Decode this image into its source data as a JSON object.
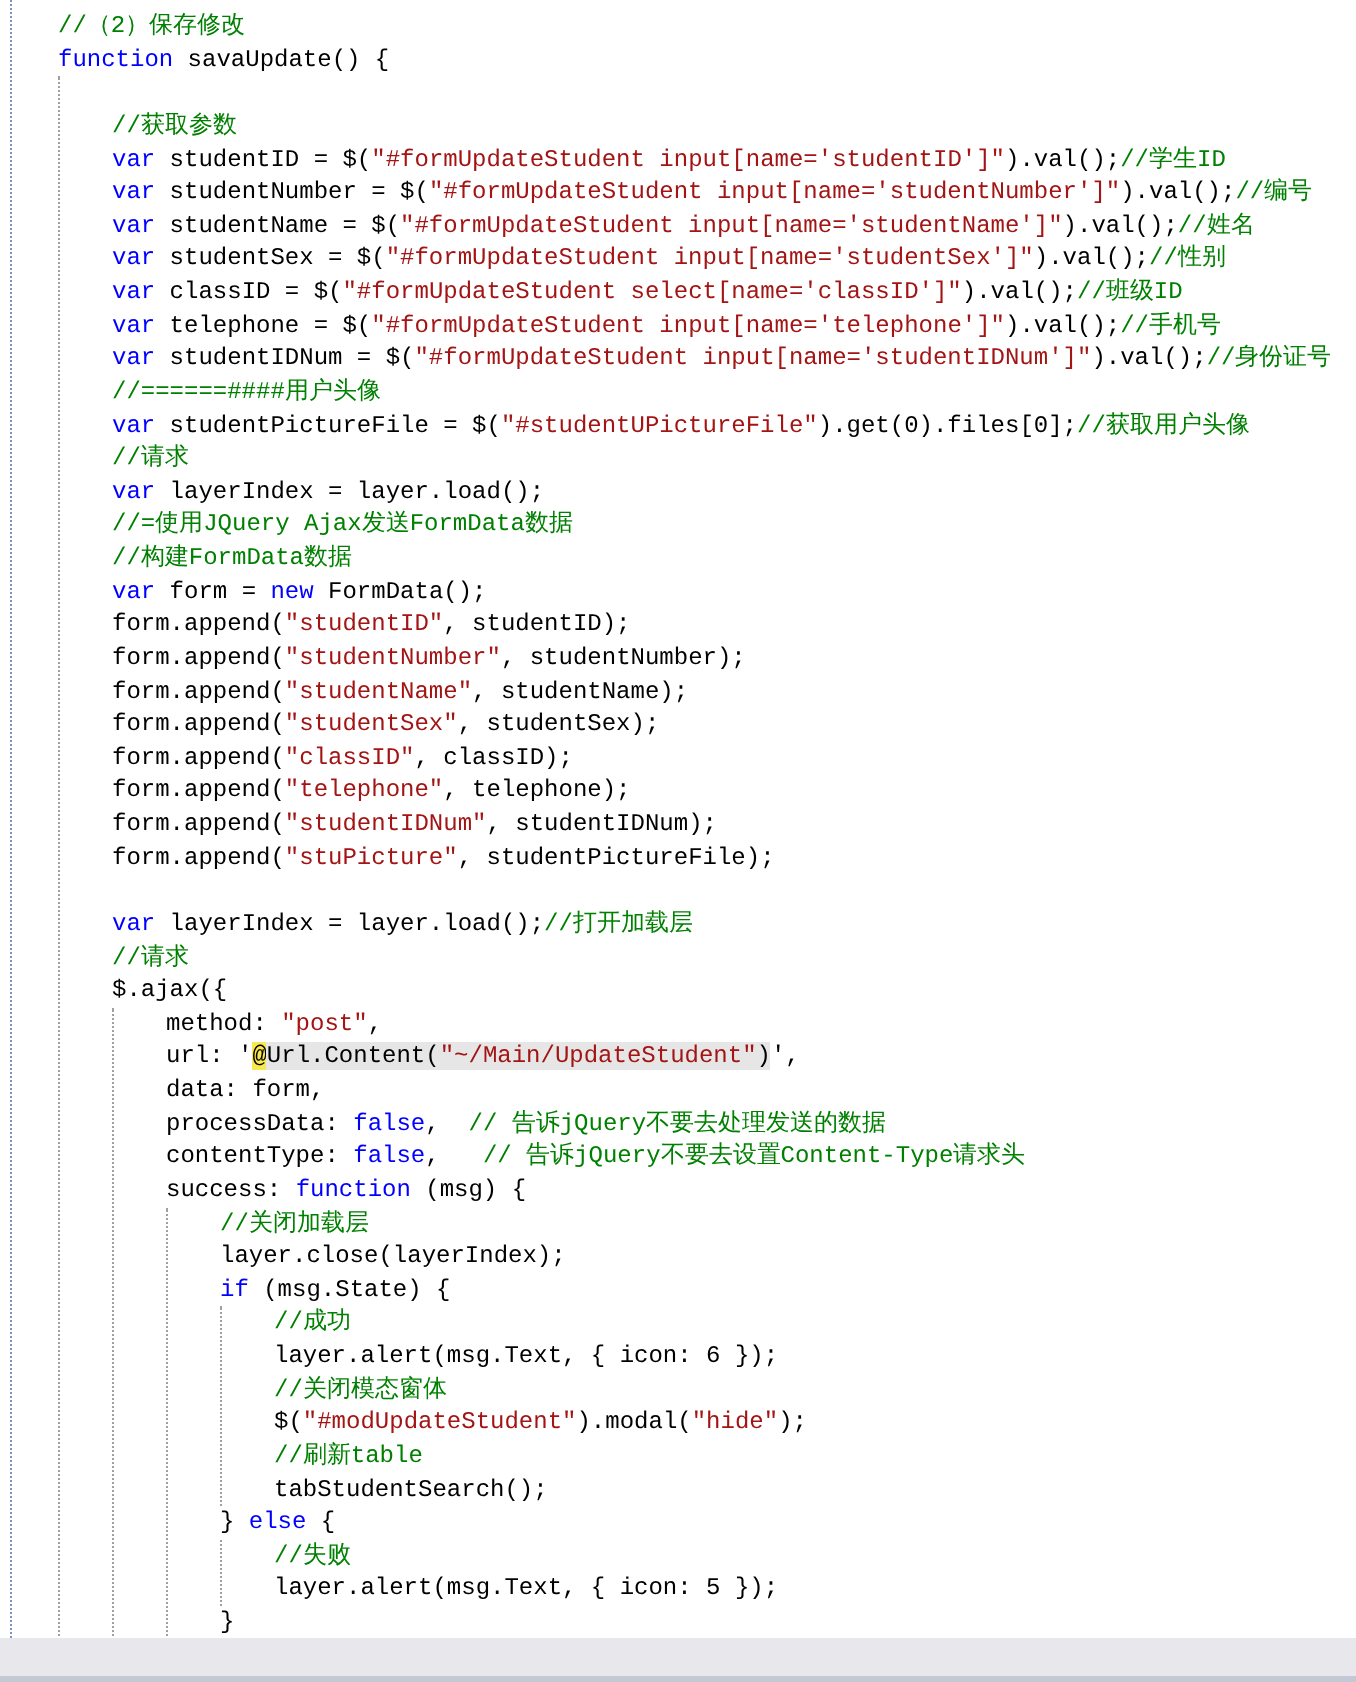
{
  "editor": {
    "lines": [
      {
        "kind": "code",
        "tokens": [
          {
            "kind": "cmt",
            "text": "//（2）保存修改"
          }
        ]
      },
      {
        "kind": "code",
        "tokens": [
          {
            "kind": "kw",
            "text": "function"
          },
          {
            "kind": "plain",
            "text": " savaUpdate() {"
          }
        ],
        "children": [
          {
            "kind": "blank"
          },
          {
            "kind": "code",
            "tokens": [
              {
                "kind": "cmt",
                "text": "//获取参数"
              }
            ]
          },
          {
            "kind": "code",
            "tokens": [
              {
                "kind": "kw",
                "text": "var"
              },
              {
                "kind": "plain",
                "text": " studentID = $("
              },
              {
                "kind": "str",
                "text": "\"#formUpdateStudent input[name='studentID']\""
              },
              {
                "kind": "plain",
                "text": ").val();"
              },
              {
                "kind": "cmt",
                "text": "//学生ID"
              }
            ]
          },
          {
            "kind": "code",
            "tokens": [
              {
                "kind": "kw",
                "text": "var"
              },
              {
                "kind": "plain",
                "text": " studentNumber = $("
              },
              {
                "kind": "str",
                "text": "\"#formUpdateStudent input[name='studentNumber']\""
              },
              {
                "kind": "plain",
                "text": ").val();"
              },
              {
                "kind": "cmt",
                "text": "//编号"
              }
            ]
          },
          {
            "kind": "code",
            "tokens": [
              {
                "kind": "kw",
                "text": "var"
              },
              {
                "kind": "plain",
                "text": " studentName = $("
              },
              {
                "kind": "str",
                "text": "\"#formUpdateStudent input[name='studentName']\""
              },
              {
                "kind": "plain",
                "text": ").val();"
              },
              {
                "kind": "cmt",
                "text": "//姓名"
              }
            ]
          },
          {
            "kind": "code",
            "tokens": [
              {
                "kind": "kw",
                "text": "var"
              },
              {
                "kind": "plain",
                "text": " studentSex = $("
              },
              {
                "kind": "str",
                "text": "\"#formUpdateStudent input[name='studentSex']\""
              },
              {
                "kind": "plain",
                "text": ").val();"
              },
              {
                "kind": "cmt",
                "text": "//性别"
              }
            ]
          },
          {
            "kind": "code",
            "tokens": [
              {
                "kind": "kw",
                "text": "var"
              },
              {
                "kind": "plain",
                "text": " classID = $("
              },
              {
                "kind": "str",
                "text": "\"#formUpdateStudent select[name='classID']\""
              },
              {
                "kind": "plain",
                "text": ").val();"
              },
              {
                "kind": "cmt",
                "text": "//班级ID"
              }
            ]
          },
          {
            "kind": "code",
            "tokens": [
              {
                "kind": "kw",
                "text": "var"
              },
              {
                "kind": "plain",
                "text": " telephone = $("
              },
              {
                "kind": "str",
                "text": "\"#formUpdateStudent input[name='telephone']\""
              },
              {
                "kind": "plain",
                "text": ").val();"
              },
              {
                "kind": "cmt",
                "text": "//手机号"
              }
            ]
          },
          {
            "kind": "code",
            "tokens": [
              {
                "kind": "kw",
                "text": "var"
              },
              {
                "kind": "plain",
                "text": " studentIDNum = $("
              },
              {
                "kind": "str",
                "text": "\"#formUpdateStudent input[name='studentIDNum']\""
              },
              {
                "kind": "plain",
                "text": ").val();"
              },
              {
                "kind": "cmt",
                "text": "//身份证号"
              }
            ]
          },
          {
            "kind": "code",
            "tokens": [
              {
                "kind": "cmt",
                "text": "//======####用户头像"
              }
            ]
          },
          {
            "kind": "code",
            "tokens": [
              {
                "kind": "kw",
                "text": "var"
              },
              {
                "kind": "plain",
                "text": " studentPictureFile = $("
              },
              {
                "kind": "str",
                "text": "\"#studentUPictureFile\""
              },
              {
                "kind": "plain",
                "text": ").get(0).files[0];"
              },
              {
                "kind": "cmt",
                "text": "//获取用户头像"
              }
            ]
          },
          {
            "kind": "code",
            "tokens": [
              {
                "kind": "cmt",
                "text": "//请求"
              }
            ]
          },
          {
            "kind": "code",
            "tokens": [
              {
                "kind": "kw",
                "text": "var"
              },
              {
                "kind": "plain",
                "text": " layerIndex = layer.load();"
              }
            ]
          },
          {
            "kind": "code",
            "tokens": [
              {
                "kind": "cmt",
                "text": "//=使用JQuery Ajax发送FormData数据"
              }
            ]
          },
          {
            "kind": "code",
            "tokens": [
              {
                "kind": "cmt",
                "text": "//构建FormData数据"
              }
            ]
          },
          {
            "kind": "code",
            "tokens": [
              {
                "kind": "kw",
                "text": "var"
              },
              {
                "kind": "plain",
                "text": " form = "
              },
              {
                "kind": "kw",
                "text": "new"
              },
              {
                "kind": "plain",
                "text": " FormData();"
              }
            ]
          },
          {
            "kind": "code",
            "tokens": [
              {
                "kind": "plain",
                "text": "form.append("
              },
              {
                "kind": "str",
                "text": "\"studentID\""
              },
              {
                "kind": "plain",
                "text": ", studentID);"
              }
            ]
          },
          {
            "kind": "code",
            "tokens": [
              {
                "kind": "plain",
                "text": "form.append("
              },
              {
                "kind": "str",
                "text": "\"studentNumber\""
              },
              {
                "kind": "plain",
                "text": ", studentNumber);"
              }
            ]
          },
          {
            "kind": "code",
            "tokens": [
              {
                "kind": "plain",
                "text": "form.append("
              },
              {
                "kind": "str",
                "text": "\"studentName\""
              },
              {
                "kind": "plain",
                "text": ", studentName);"
              }
            ]
          },
          {
            "kind": "code",
            "tokens": [
              {
                "kind": "plain",
                "text": "form.append("
              },
              {
                "kind": "str",
                "text": "\"studentSex\""
              },
              {
                "kind": "plain",
                "text": ", studentSex);"
              }
            ]
          },
          {
            "kind": "code",
            "tokens": [
              {
                "kind": "plain",
                "text": "form.append("
              },
              {
                "kind": "str",
                "text": "\"classID\""
              },
              {
                "kind": "plain",
                "text": ", classID);"
              }
            ]
          },
          {
            "kind": "code",
            "tokens": [
              {
                "kind": "plain",
                "text": "form.append("
              },
              {
                "kind": "str",
                "text": "\"telephone\""
              },
              {
                "kind": "plain",
                "text": ", telephone);"
              }
            ]
          },
          {
            "kind": "code",
            "tokens": [
              {
                "kind": "plain",
                "text": "form.append("
              },
              {
                "kind": "str",
                "text": "\"studentIDNum\""
              },
              {
                "kind": "plain",
                "text": ", studentIDNum);"
              }
            ]
          },
          {
            "kind": "code",
            "tokens": [
              {
                "kind": "plain",
                "text": "form.append("
              },
              {
                "kind": "str",
                "text": "\"stuPicture\""
              },
              {
                "kind": "plain",
                "text": ", studentPictureFile);"
              }
            ]
          },
          {
            "kind": "blank"
          },
          {
            "kind": "code",
            "tokens": [
              {
                "kind": "kw",
                "text": "var"
              },
              {
                "kind": "plain",
                "text": " layerIndex = layer.load();"
              },
              {
                "kind": "cmt",
                "text": "//打开加载层"
              }
            ]
          },
          {
            "kind": "code",
            "tokens": [
              {
                "kind": "cmt",
                "text": "//请求"
              }
            ]
          },
          {
            "kind": "code",
            "tokens": [
              {
                "kind": "plain",
                "text": "$.ajax({"
              }
            ],
            "children": [
              {
                "kind": "code",
                "tokens": [
                  {
                    "kind": "plain",
                    "text": "method: "
                  },
                  {
                    "kind": "str",
                    "text": "\"post\""
                  },
                  {
                    "kind": "plain",
                    "text": ","
                  }
                ]
              },
              {
                "kind": "code",
                "tokens": [
                  {
                    "kind": "plain",
                    "text": "url: '"
                  },
                  {
                    "kind": "razor-at",
                    "text": "@"
                  },
                  {
                    "kind": "razor",
                    "text": "Url.Content("
                  },
                  {
                    "kind": "razor-str",
                    "text": "\"~/Main/UpdateStudent\""
                  },
                  {
                    "kind": "razor",
                    "text": ")"
                  },
                  {
                    "kind": "plain",
                    "text": "',"
                  }
                ]
              },
              {
                "kind": "code",
                "tokens": [
                  {
                    "kind": "plain",
                    "text": "data: form,"
                  }
                ]
              },
              {
                "kind": "code",
                "tokens": [
                  {
                    "kind": "plain",
                    "text": "processData: "
                  },
                  {
                    "kind": "kw",
                    "text": "false"
                  },
                  {
                    "kind": "plain",
                    "text": ",  "
                  },
                  {
                    "kind": "cmt",
                    "text": "// 告诉jQuery不要去处理发送的数据"
                  }
                ]
              },
              {
                "kind": "code",
                "tokens": [
                  {
                    "kind": "plain",
                    "text": "contentType: "
                  },
                  {
                    "kind": "kw",
                    "text": "false"
                  },
                  {
                    "kind": "plain",
                    "text": ",   "
                  },
                  {
                    "kind": "cmt",
                    "text": "// 告诉jQuery不要去设置Content-Type请求头"
                  }
                ]
              },
              {
                "kind": "code",
                "tokens": [
                  {
                    "kind": "plain",
                    "text": "success: "
                  },
                  {
                    "kind": "kw",
                    "text": "function"
                  },
                  {
                    "kind": "plain",
                    "text": " (msg) {"
                  }
                ],
                "children": [
                  {
                    "kind": "code",
                    "tokens": [
                      {
                        "kind": "cmt",
                        "text": "//关闭加载层"
                      }
                    ]
                  },
                  {
                    "kind": "code",
                    "tokens": [
                      {
                        "kind": "plain",
                        "text": "layer.close(layerIndex);"
                      }
                    ]
                  },
                  {
                    "kind": "code",
                    "tokens": [
                      {
                        "kind": "kw",
                        "text": "if"
                      },
                      {
                        "kind": "plain",
                        "text": " (msg.State) {"
                      }
                    ],
                    "children": [
                      {
                        "kind": "code",
                        "tokens": [
                          {
                            "kind": "cmt",
                            "text": "//成功"
                          }
                        ]
                      },
                      {
                        "kind": "code",
                        "tokens": [
                          {
                            "kind": "plain",
                            "text": "layer.alert(msg.Text, { icon: 6 });"
                          }
                        ]
                      },
                      {
                        "kind": "code",
                        "tokens": [
                          {
                            "kind": "cmt",
                            "text": "//关闭模态窗体"
                          }
                        ]
                      },
                      {
                        "kind": "code",
                        "tokens": [
                          {
                            "kind": "plain",
                            "text": "$("
                          },
                          {
                            "kind": "str",
                            "text": "\"#modUpdateStudent\""
                          },
                          {
                            "kind": "plain",
                            "text": ").modal("
                          },
                          {
                            "kind": "str",
                            "text": "\"hide\""
                          },
                          {
                            "kind": "plain",
                            "text": ");"
                          }
                        ]
                      },
                      {
                        "kind": "code",
                        "tokens": [
                          {
                            "kind": "cmt",
                            "text": "//刷新table"
                          }
                        ]
                      },
                      {
                        "kind": "code",
                        "tokens": [
                          {
                            "kind": "plain",
                            "text": "tabStudentSearch();"
                          }
                        ]
                      }
                    ]
                  },
                  {
                    "kind": "code",
                    "tokens": [
                      {
                        "kind": "plain",
                        "text": "} "
                      },
                      {
                        "kind": "kw",
                        "text": "else"
                      },
                      {
                        "kind": "plain",
                        "text": " {"
                      }
                    ],
                    "children": [
                      {
                        "kind": "code",
                        "tokens": [
                          {
                            "kind": "cmt",
                            "text": "//失败"
                          }
                        ]
                      },
                      {
                        "kind": "code",
                        "tokens": [
                          {
                            "kind": "plain",
                            "text": "layer.alert(msg.Text, { icon: 5 });"
                          }
                        ]
                      }
                    ]
                  },
                  {
                    "kind": "code",
                    "tokens": [
                      {
                        "kind": "plain",
                        "text": "}"
                      }
                    ]
                  }
                ]
              }
            ]
          }
        ]
      }
    ]
  }
}
